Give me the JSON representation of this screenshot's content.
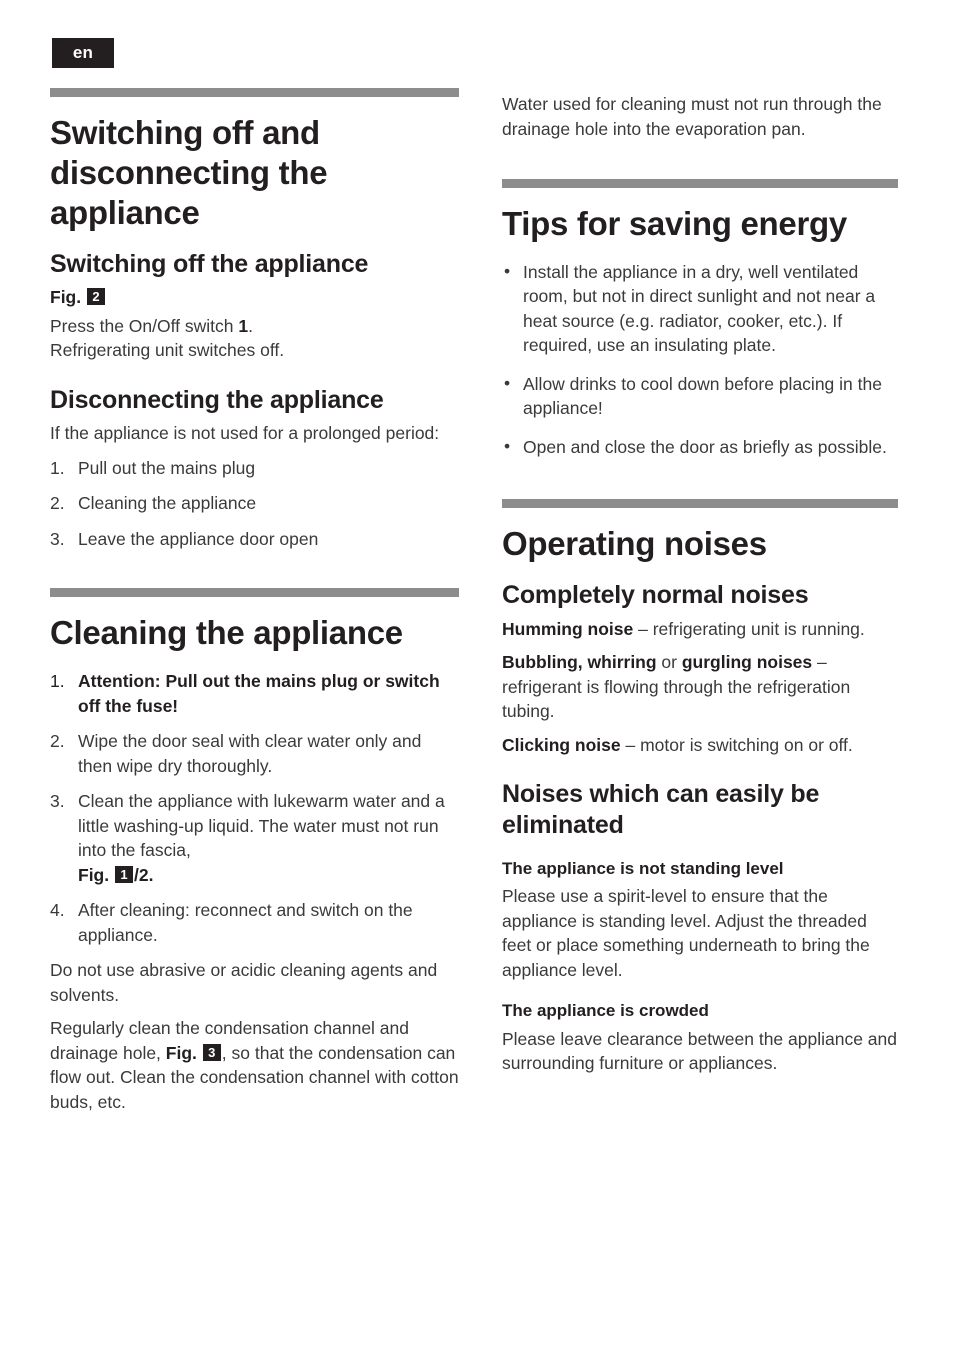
{
  "page": {
    "language_badge": "en"
  },
  "left_column": {
    "section1": {
      "title": "Switching off and disconnecting the appliance",
      "sub1": {
        "heading": "Switching off the appliance",
        "fig_label": "Fig.",
        "fig_number": "2",
        "paragraph_line1_a": "Press the On/Off switch ",
        "paragraph_line1_b": "1",
        "paragraph_line1_c": ".",
        "paragraph_line2": "Refrigerating unit switches off."
      },
      "sub2": {
        "heading": "Disconnecting the appliance",
        "intro": "If the appliance is not used for a prolonged period:",
        "steps": [
          {
            "marker": "1.",
            "text": "Pull out the mains plug"
          },
          {
            "marker": "2.",
            "text": "Cleaning the appliance"
          },
          {
            "marker": "3.",
            "text": "Leave the appliance door open"
          }
        ]
      }
    },
    "section2": {
      "title": "Cleaning the appliance",
      "steps": [
        {
          "marker": "1.",
          "text": "Attention: Pull out the mains plug or switch off the fuse!",
          "bold": true
        },
        {
          "marker": "2.",
          "text": "Wipe the door seal with clear water only and then wipe dry thoroughly.",
          "bold": false
        },
        {
          "marker": "3.",
          "text": "Clean the appliance with lukewarm water and a little washing-up liquid. The water must not run into the fascia,",
          "bold": false
        },
        {
          "marker": "4.",
          "text": "After cleaning: reconnect and switch on the appliance.",
          "bold": false
        }
      ],
      "step3_fig_label": "Fig.",
      "step3_fig_number": "1",
      "step3_fig_suffix": "/2.",
      "para_after_steps": "Do not use abrasive or acidic cleaning agents and solvents.",
      "para_condensation_a": "Regularly clean the condensation channel and drainage hole, ",
      "para_condensation_fig_label": "Fig.",
      "para_condensation_fig_number": "3",
      "para_condensation_b": ", so that the condensation can flow out. Clean the condensation channel with cotton buds, etc."
    }
  },
  "right_column": {
    "intro_paragraph": "Water used for cleaning must not run through the drainage hole into the evaporation pan.",
    "section3": {
      "title": "Tips for saving energy",
      "bullets": [
        "Install the appliance in a dry, well ventilated room, but not in direct sunlight and not near a heat source (e.g. radiator, cooker, etc.). If required, use an insulating plate.",
        "Allow drinks to cool down before placing in the appliance!",
        "Open and close the door as briefly as possible."
      ]
    },
    "section4": {
      "title": "Operating noises",
      "sub1": {
        "heading": "Completely normal noises",
        "items": [
          {
            "bold": "Humming noise",
            "rest": " – refrigerating unit is running."
          },
          {
            "bold": "Bubbling, whirring",
            "mid": " or ",
            "bold2": "gurgling noises",
            "rest": " – refrigerant is flowing through the refrigeration tubing."
          },
          {
            "bold": "Clicking noise",
            "rest": " – motor is switching on or off."
          }
        ]
      },
      "sub2": {
        "heading": "Noises which can easily be eliminated",
        "blocks": [
          {
            "heading": "The appliance is not standing level",
            "text": "Please use a spirit-level to ensure that the appliance is standing level. Adjust the threaded feet or place something underneath to bring the appliance level."
          },
          {
            "heading": "The appliance is crowded",
            "text": "Please leave clearance between the appliance and surrounding furniture or appliances."
          }
        ]
      }
    }
  }
}
